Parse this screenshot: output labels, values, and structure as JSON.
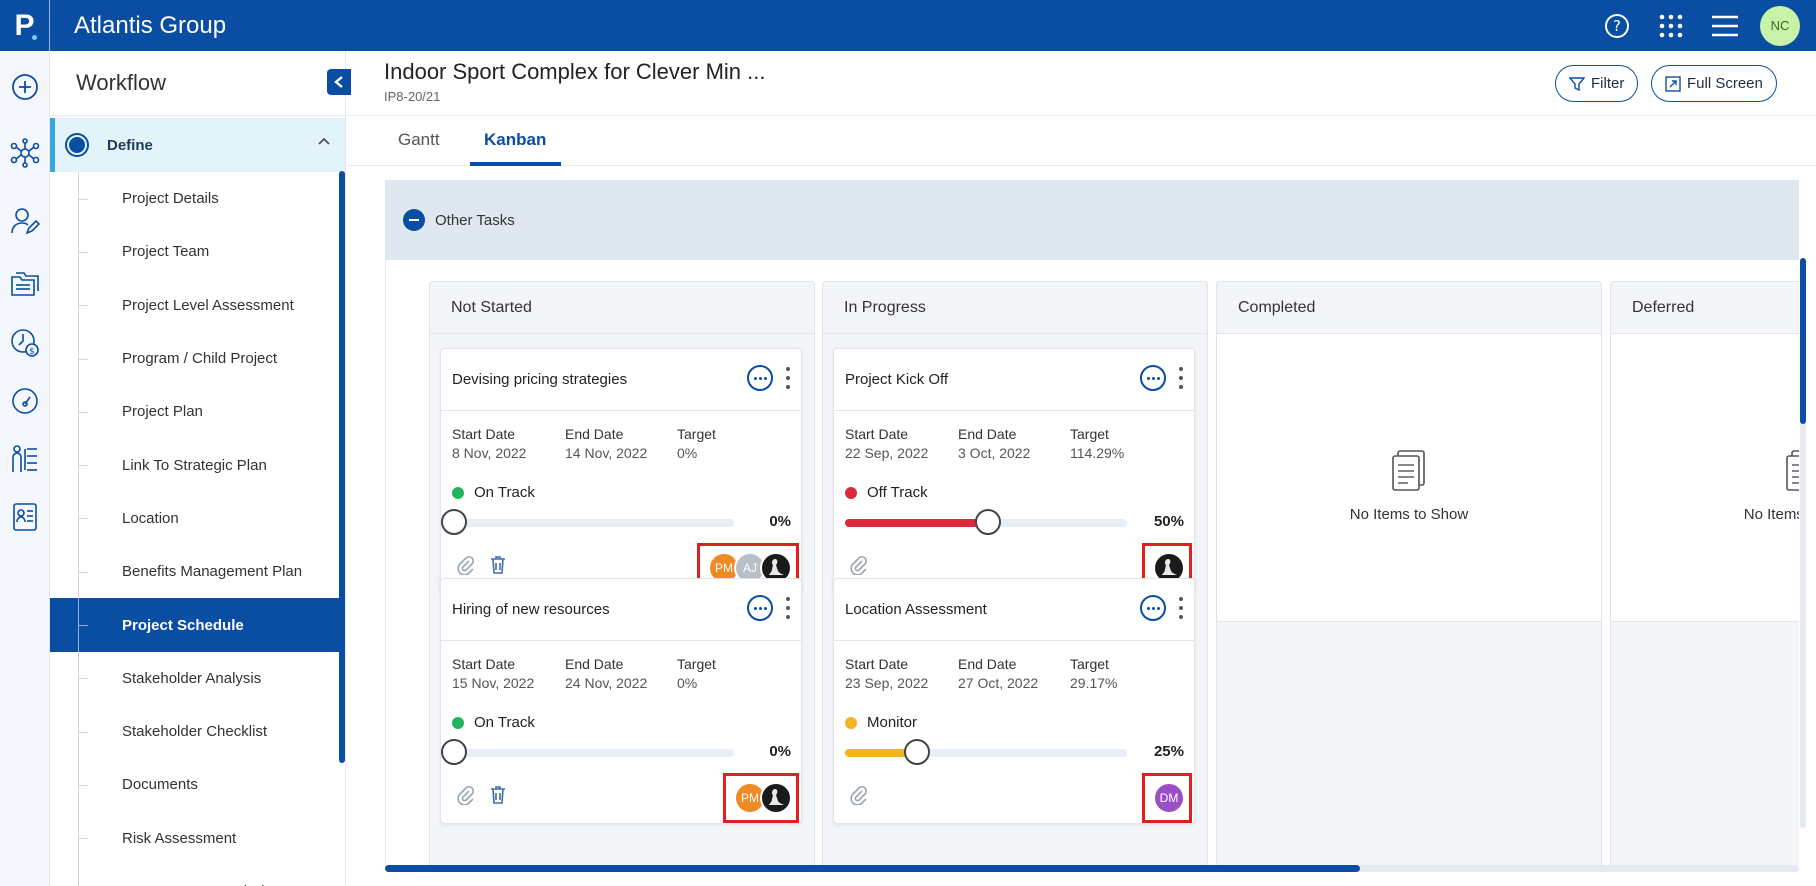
{
  "app": {
    "title": "Atlantis Group",
    "logo": "P",
    "user_initials": "NC"
  },
  "top_icons": [
    "help-icon",
    "apps-grid-icon",
    "menu-icon"
  ],
  "rail_icons": [
    "add-icon",
    "network-icon",
    "user-edit-icon",
    "folders-icon",
    "time-money-icon",
    "dashboard-gauge-icon",
    "org-chart-icon",
    "report-icon"
  ],
  "sidebar": {
    "title": "Workflow",
    "section": "Define",
    "items": [
      {
        "label": "Project Details"
      },
      {
        "label": "Project Team"
      },
      {
        "label": "Project Level Assessment"
      },
      {
        "label": "Program / Child Project"
      },
      {
        "label": "Project Plan"
      },
      {
        "label": "Link To Strategic Plan"
      },
      {
        "label": "Location"
      },
      {
        "label": "Benefits Management Plan"
      },
      {
        "label": "Project Schedule"
      },
      {
        "label": "Stakeholder Analysis"
      },
      {
        "label": "Stakeholder Checklist"
      },
      {
        "label": "Documents"
      },
      {
        "label": "Risk Assessment"
      },
      {
        "label": "Resource Demand Plan"
      }
    ],
    "active_item": "Project Schedule"
  },
  "header": {
    "title": "Indoor Sport Complex for Clever Min ...",
    "code": "IP8-20/21",
    "filter_label": "Filter",
    "fullscreen_label": "Full Screen"
  },
  "tabs": [
    {
      "label": "Gantt"
    },
    {
      "label": "Kanban"
    }
  ],
  "active_tab": "Kanban",
  "group": {
    "label": "Other Tasks"
  },
  "field_labels": {
    "start": "Start Date",
    "end": "End Date",
    "target": "Target"
  },
  "columns": [
    {
      "title": "Not Started",
      "cards": [
        {
          "title": "Devising pricing strategies",
          "start": "8 Nov, 2022",
          "end": "14 Nov, 2022",
          "target": "0%",
          "status": "On Track",
          "status_color": "#22b35e",
          "progress": 0,
          "progress_label": "0%",
          "has_delete": true,
          "avatars": [
            "PM",
            "AJ",
            "img"
          ]
        },
        {
          "title": "Hiring of new resources",
          "start": "15 Nov, 2022",
          "end": "24 Nov, 2022",
          "target": "0%",
          "status": "On Track",
          "status_color": "#22b35e",
          "progress": 0,
          "progress_label": "0%",
          "has_delete": true,
          "avatars": [
            "PM",
            "img"
          ]
        }
      ]
    },
    {
      "title": "In Progress",
      "cards": [
        {
          "title": "Project Kick Off",
          "start": "22 Sep, 2022",
          "end": "3 Oct, 2022",
          "target": "114.29%",
          "status": "Off Track",
          "status_color": "#dc2a3c",
          "progress": 50,
          "progress_label": "50%",
          "has_delete": false,
          "avatars": [
            "img"
          ]
        },
        {
          "title": "Location Assessment",
          "start": "23 Sep, 2022",
          "end": "27 Oct, 2022",
          "target": "29.17%",
          "status": "Monitor",
          "status_color": "#f5b323",
          "progress": 25,
          "progress_label": "25%",
          "has_delete": false,
          "avatars": [
            "DM"
          ]
        }
      ]
    },
    {
      "title": "Completed",
      "cards": [],
      "empty_text": "No Items to Show"
    },
    {
      "title": "Deferred",
      "cards": [],
      "empty_text": "No Items to Show"
    }
  ],
  "colors": {
    "primary": "#0a4ea3",
    "highlight_border": "#e02020"
  }
}
